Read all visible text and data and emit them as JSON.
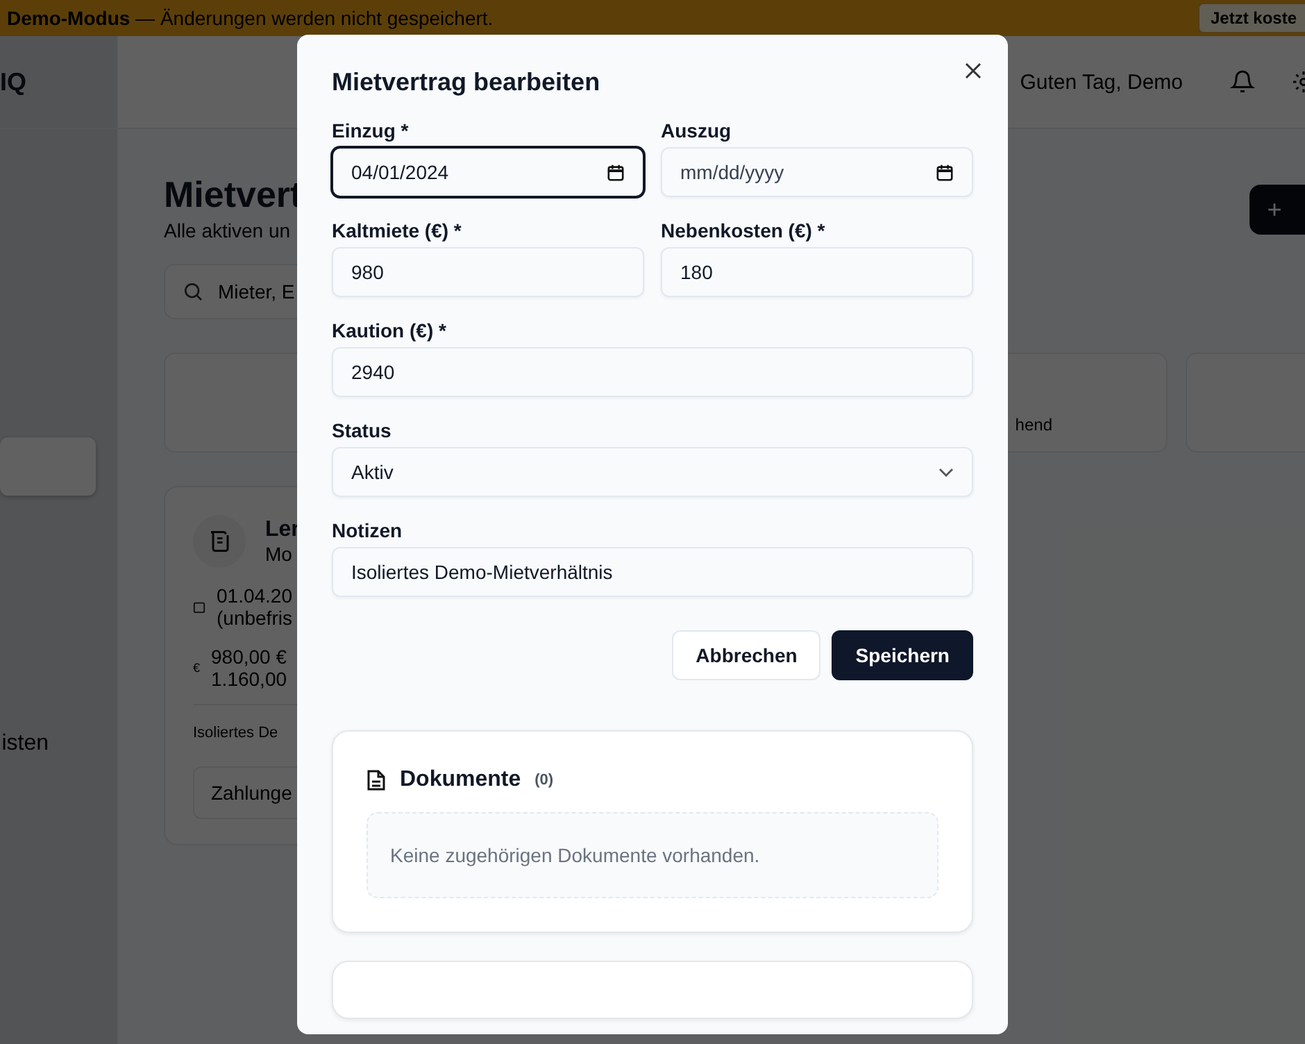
{
  "banner": {
    "text": "**Demo-Modus** — Änderungen werden nicht gespeichert.",
    "button": "Jetzt koste"
  },
  "header": {
    "greeting": "Guten Tag, Demo"
  },
  "sidebar": {
    "logo": "IQ",
    "items": [
      {
        "selected": true
      },
      {
        "label": "isten",
        "selected": false
      }
    ]
  },
  "page": {
    "title": "Mietvert",
    "subtitle": "Alle aktiven un",
    "search": {
      "placeholder": "Mieter, E"
    },
    "add_button": "+",
    "stat_cards": [
      {
        "label": "hend"
      }
    ],
    "contract": {
      "title": "Ler",
      "subtitle": "Mo",
      "dates": [
        "01.04.20",
        "(unbefris"
      ],
      "amount_icon": "€",
      "amounts": [
        "980,00 €",
        "1.160,00"
      ],
      "note": "Isoliertes De",
      "button": "Zahlunge"
    }
  },
  "modal": {
    "title": "Mietvertrag bearbeiten",
    "fields": [
      {
        "kind": "date",
        "label": "Einzug *",
        "value": "04/01/2024",
        "focused": true,
        "wide": false
      },
      {
        "kind": "date",
        "label": "Auszug",
        "placeholder": "mm/dd/yyyy",
        "focused": false,
        "wide": false
      },
      {
        "kind": "text",
        "label": "Kaltmiete (€) *",
        "value": "980",
        "focused": false,
        "wide": false
      },
      {
        "kind": "text",
        "label": "Nebenkosten (€) *",
        "value": "180",
        "focused": false,
        "wide": false
      },
      {
        "kind": "text",
        "label": "Kaution (€) *",
        "value": "2940",
        "focused": false,
        "wide": true
      },
      {
        "kind": "select",
        "label": "Status",
        "value": "Aktiv",
        "focused": false,
        "wide": true
      },
      {
        "kind": "text",
        "label": "Notizen",
        "value": "Isoliertes Demo-Mietverhältnis",
        "focused": false,
        "wide": true
      }
    ],
    "buttons": [
      {
        "label": "Abbrechen",
        "kind": "secondary"
      },
      {
        "label": "Speichern",
        "kind": "primary"
      }
    ],
    "documents": {
      "title": "Dokumente",
      "count": "(0)",
      "empty": "Keine zugehörigen Dokumente vorhanden."
    }
  }
}
